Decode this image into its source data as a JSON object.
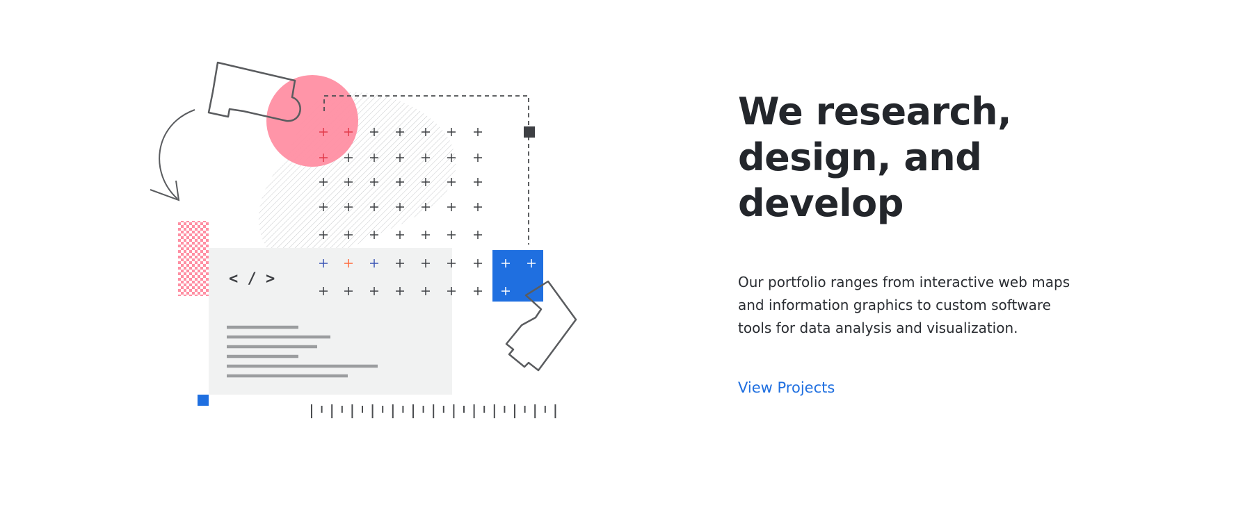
{
  "hero": {
    "headline": "We research, design, and develop",
    "description": "Our portfolio ranges from interactive web maps and information graphics to custom software tools for data analysis and visualization.",
    "cta_label": "View Projects"
  },
  "illustration": {
    "code_symbol": "< / >",
    "icons": [
      "arrow-icon",
      "puzzle-piece-icon",
      "checkerboard-pattern",
      "plus-grid",
      "code-window",
      "ruler-ticks"
    ]
  },
  "colors": {
    "headline": "#23262b",
    "link": "#1f6fe0",
    "accent_blue": "#1f6fe0",
    "accent_pink": "#ff8fa3",
    "panel_gray": "#f1f2f2"
  }
}
